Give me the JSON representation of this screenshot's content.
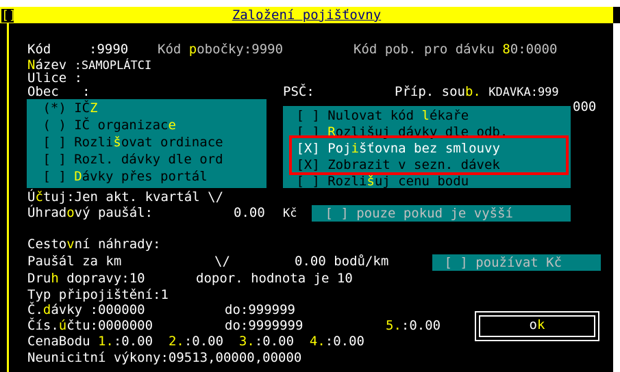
{
  "window": {
    "title": "Založení pojišťovny",
    "close_glyph": "[]"
  },
  "header_line": {
    "kod_label": "Kód",
    "kod_value": ":9990",
    "pobocka_pre": "Kód ",
    "pobocka_hot": "p",
    "pobocka_post": "obočky:9990",
    "davka_pre": "Kód pob. pro dávku ",
    "davka_hot": "8",
    "davka_post": "0:0000"
  },
  "nazev": {
    "hot": "N",
    "label": "ázev",
    "value": ":SAMOPLÁTCI"
  },
  "ulice": {
    "label": "Ulice :"
  },
  "obec": {
    "label": "Obec   :"
  },
  "psc": {
    "label": "PSČ:"
  },
  "prip_soub": {
    "pre": "Příp. sou",
    "hot": "b.",
    "value": "KDAVKA:999"
  },
  "behind_value": "000",
  "left_panel": {
    "items": [
      {
        "mark": " (*) ",
        "pre": "IČ",
        "hot": "Z",
        "post": ""
      },
      {
        "mark": " ( ) ",
        "pre": "IČ organizac",
        "hot": "e",
        "post": ""
      },
      {
        "mark": " [ ] ",
        "pre": "Rozli",
        "hot": "š",
        "post": "ovat ordinace"
      },
      {
        "mark": " [ ] ",
        "pre": "Rozl. dávky dle ord",
        "hot": "",
        "post": ""
      },
      {
        "mark": " [ ] ",
        "pre": "",
        "hot": "D",
        "post": "ávky přes portál"
      }
    ]
  },
  "right_panel": {
    "items": [
      {
        "mark": " [ ] ",
        "pre": "Nulovat kód ",
        "hot": "l",
        "post": "ékaře"
      },
      {
        "mark": " [ ] ",
        "pre": "",
        "hot": "R",
        "post": "ozlišuj dávky dle odb."
      },
      {
        "mark": " [X] ",
        "pre": "Poj",
        "hot": "i",
        "post": "šťovna bez smlouvy"
      },
      {
        "mark": " [X] ",
        "pre": "Zobrazit v sezn. dávek",
        "hot": "",
        "post": ""
      },
      {
        "mark": " [ ] ",
        "pre": "Rozli",
        "hot": "š",
        "post": "uj cenu bodu"
      }
    ]
  },
  "uctuj": {
    "pre": "Ú",
    "hot": "č",
    "post": "tuj:Jen akt. kvartál ",
    "arrow": "\\/"
  },
  "uhrad": {
    "pre": "Úhrad",
    "hot": "o",
    "post": "vý paušál:",
    "amount": "0.00",
    "currency": "Kč",
    "check": " [ ] pouze pokud je vyšší "
  },
  "cestovni": {
    "pre": "Cesto",
    "hot": "v",
    "post": "ní náhrady:"
  },
  "pausal_km": {
    "label": "Paušál za km",
    "arrow": "\\/",
    "amount": "0.00 bodů/km",
    "check": " [ ] používat Kč "
  },
  "druh": {
    "pre": "Dru",
    "hot": "h",
    "post": " dopravy:10",
    "hint": "dopor. hodnota je 10"
  },
  "typ": {
    "label": "Typ připojištění:1"
  },
  "cdavky": {
    "pre": "Č.",
    "hot": "d",
    "post": "ávky :000000",
    "do": "do:999999"
  },
  "cisuctu": {
    "pre": "Čís.",
    "hot": "ú",
    "post": "čtu:0000000",
    "do": "do:9999999",
    "five_hot": "5.",
    "five_val": ":0.00"
  },
  "cena": {
    "label": "CenaBodu ",
    "one_hot": "1.",
    "one_val": ":0.00",
    "two_hot": "2.",
    "two_val": ":0.00",
    "three_hot": "3.",
    "three_val": ":0.00",
    "four_hot": "4.",
    "four_val": ":0.00"
  },
  "neunic": {
    "label": "Neunicitní výkony:09513,00000,00000"
  },
  "ok_button": {
    "pre": "o",
    "hot": "k"
  },
  "colors": {
    "background": "#000000",
    "accent": "#ffff00",
    "panel": "#008080",
    "highlight": "#ff0000"
  }
}
